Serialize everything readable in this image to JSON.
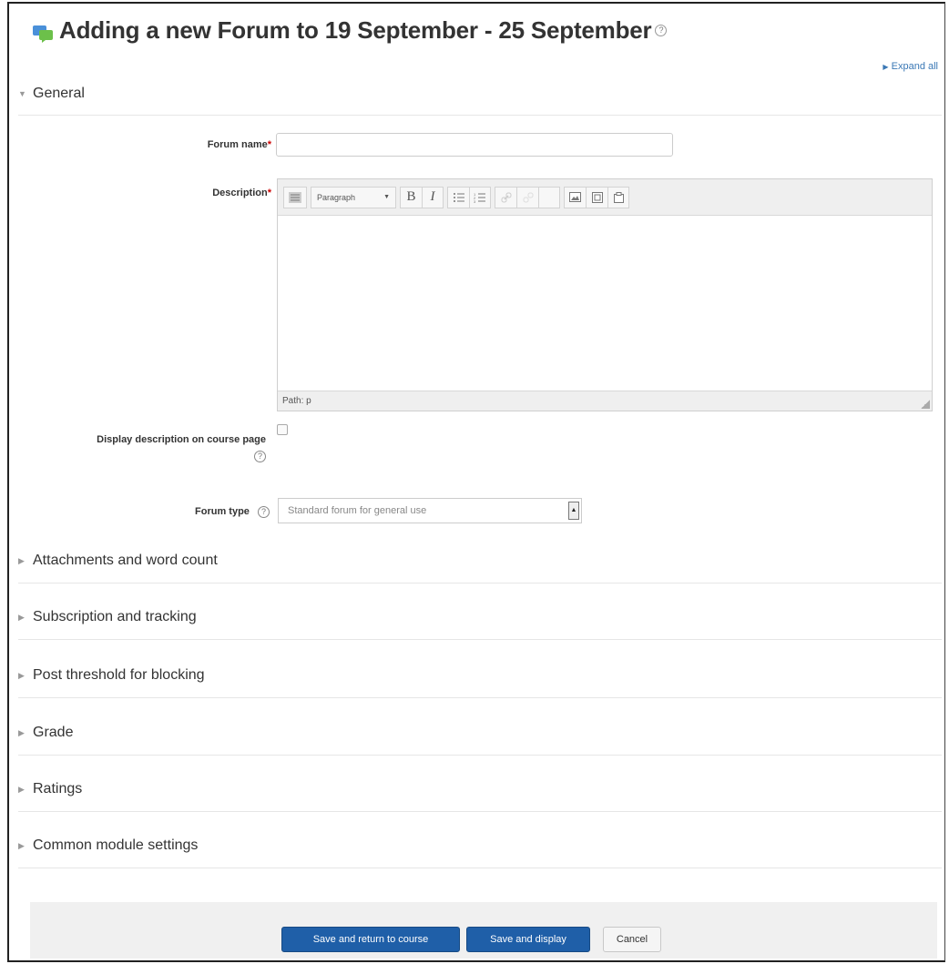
{
  "page": {
    "title": "Adding a new Forum to 19 September - 25 September",
    "expand_all": "Expand all"
  },
  "general": {
    "header": "General",
    "forum_name_label": "Forum name",
    "required_mark": "*",
    "forum_name_value": "",
    "description_label": "Description",
    "editor": {
      "format_select": "Paragraph",
      "status_path": "Path: p",
      "buttons": [
        "toolbar-toggle",
        "bold",
        "italic",
        "unordered-list",
        "ordered-list",
        "link",
        "unlink",
        "anchor",
        "image",
        "media",
        "manage-files"
      ]
    },
    "display_description_label": "Display description on course page",
    "display_description_checked": false,
    "forum_type_label": "Forum type",
    "forum_type_value": "Standard forum for general use"
  },
  "sections": [
    {
      "label": "Attachments and word count"
    },
    {
      "label": "Subscription and tracking"
    },
    {
      "label": "Post threshold for blocking"
    },
    {
      "label": "Grade"
    },
    {
      "label": "Ratings"
    },
    {
      "label": "Common module settings"
    }
  ],
  "buttons": {
    "save_return": "Save and return to course",
    "save_display": "Save and display",
    "cancel": "Cancel"
  },
  "colors": {
    "primary_button": "#1f5fa8",
    "link": "#3a78b5",
    "required": "#cc0000"
  }
}
